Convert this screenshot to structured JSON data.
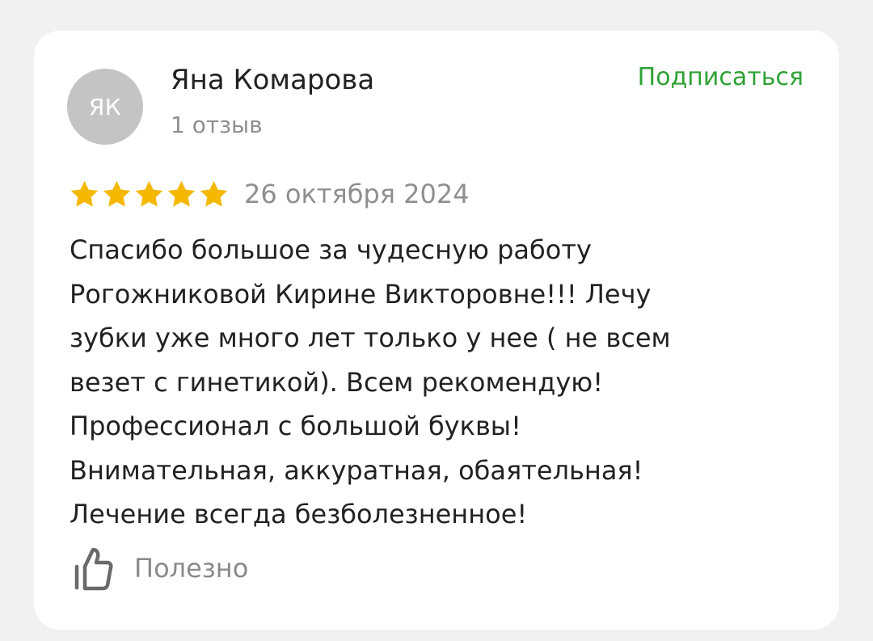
{
  "review": {
    "author": {
      "initials": "ЯК",
      "name": "Яна Комарова",
      "reviews_count": "1 отзыв"
    },
    "subscribe_label": "Подписаться",
    "rating": 5,
    "rating_max": 5,
    "date": "26 октября 2024",
    "text_lines": [
      "Спасибо большое за чудесную работу",
      "Рогожниковой Кирине Викторовне!!! Лечу",
      "зубки уже много лет только у нее ( не всем",
      "везет с гинетикой). Всем рекомендую!",
      "Профессионал с большой буквы!",
      "Внимательная, аккуратная, обаятельная!",
      "Лечение всегда безболезненное!"
    ],
    "helpful": {
      "icon": "thumbs-up-icon",
      "label": "Полезно"
    }
  },
  "colors": {
    "page_background": "#f1f1f1",
    "card_background": "#ffffff",
    "avatar_background": "#c4c4c4",
    "accent_green": "#2fa135",
    "star_gold": "#f5b800",
    "secondary_text": "#8f8f8f",
    "primary_text": "#222222"
  }
}
